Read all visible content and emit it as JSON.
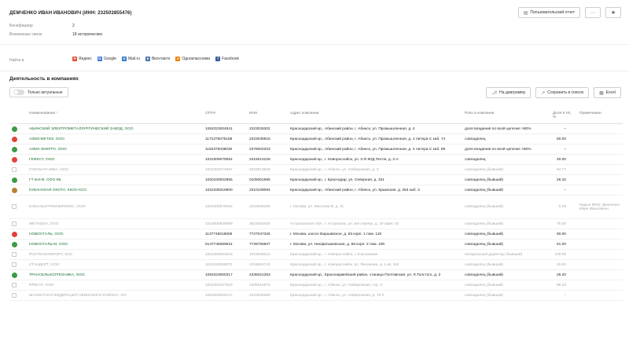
{
  "header": {
    "title": "ДЕМЧЕНКО ИВАН ИВАНОВИЧ (ИНН: 232503855476)",
    "user_report_label": "Пользовательский отчет",
    "more_label": "···",
    "star_label": "★"
  },
  "meta": [
    {
      "label": "Бенефициар",
      "value": "2"
    },
    {
      "label": "Возможные связи",
      "value": "18 исторических"
    }
  ],
  "find": {
    "label": "Найти в",
    "links": [
      {
        "label": "Яндекс",
        "icon": "yandex-icon",
        "glyph": "Я",
        "color": "#e34b32"
      },
      {
        "label": "Google",
        "icon": "google-icon",
        "glyph": "G",
        "color": "#4a7bdc"
      },
      {
        "label": "Mail.ru",
        "icon": "mailru-icon",
        "glyph": "@",
        "color": "#2a70c8"
      },
      {
        "label": "Вконтакте",
        "icon": "vk-icon",
        "glyph": "в",
        "color": "#4a76a8"
      },
      {
        "label": "Одноклассники",
        "icon": "ok-icon",
        "glyph": "о",
        "color": "#ee8208"
      },
      {
        "label": "Facebook",
        "icon": "facebook-icon",
        "glyph": "f",
        "color": "#3b5998"
      }
    ]
  },
  "section": {
    "title": "Деятельность в компаниях",
    "toggle_label": "Только актуальные",
    "diagram_label": "На диаграмму",
    "save_label": "Сохранить в список",
    "export_label": "Excel"
  },
  "table": {
    "columns": [
      "Наименование ↑",
      "ОГРН",
      "ИНН",
      "Адрес компании",
      "Роль в компании",
      "Доля в УК, %",
      "Примечание"
    ],
    "rows": [
      {
        "status": "green",
        "name": "АБИНСКИЙ ЭЛЕКТРОМЕТАЛЛУРГИЧЕСКИЙ ЗАВОД, ООО",
        "ogrn": "1062323004941",
        "inn": "2323025302",
        "address": "Краснодарский кр., Абинский район, г. Абинск, ул. Промышленная, д. 4",
        "role": "доля владения по всей цепочке >50%",
        "share": "–",
        "note": "",
        "active": true
      },
      {
        "status": "red",
        "name": "АЗМЗ-МЕТИЗ, ООО",
        "ogrn": "1172375075168",
        "inn": "2323035815",
        "address": "Краснодарский кр., Абинский район, г. Абинск, ул. Промышленная, д. 4 литера С каб. 74",
        "role": "совладелец",
        "share": "50.00",
        "note": "",
        "active": true
      },
      {
        "status": "green",
        "name": "АЗМЗ-ЭНЕРГО, ООО",
        "ogrn": "1192375038030",
        "inn": "2376002203",
        "address": "Краснодарский кр., Абинский район, г. Абинск, ул. Промышленная, д. 4 литера С каб. 69",
        "role": "доля владения по всей цепочке >50%",
        "share": "–",
        "note": "",
        "active": true
      },
      {
        "status": "red",
        "name": "ГЕФЕСТ, ООО",
        "ogrn": "1022309079054",
        "inn": "2315014226",
        "address": "Краснодарский кр., г. Новороссийск, ул. 2-Я Ж/Д Петля, д. 2-А",
        "role": "совладелец",
        "share": "20.00",
        "note": "",
        "active": true
      },
      {
        "status": "gray",
        "name": "ГОЛУБАЯ НИВА, ООО",
        "ogrn": "1022303274667",
        "inn": "2323013628",
        "address": "Краснодарский кр., г. Абинск, ул. Набережная, д. 3",
        "role": "совладелец (бывший)",
        "share": "94.77",
        "note": "",
        "active": false
      },
      {
        "status": "green",
        "name": "ГТ БАНК, ООО КБ",
        "ogrn": "1020100002955",
        "inn": "0105001895",
        "address": "Краснодарский кр., г. Краснодар, ул. Северная, д. 321",
        "role": "совладелец (бывший)",
        "share": "26.32",
        "note": "",
        "active": true
      },
      {
        "status": "brown",
        "name": "КУБАНСКАЯ ОХОТА, ККОО КСО",
        "ogrn": "1022335018900",
        "inn": "2310109094",
        "address": "Краснодарский кр., Абинский район, г. Абинск, ул. Крымская, д. 264 каб. 3",
        "role": "совладелец (бывший)",
        "share": "–",
        "note": "",
        "active": true
      },
      {
        "status": "gray",
        "name": "КУБАНЬАГРОКОМПЛЕКС, ООО",
        "ogrn": "1022300879032",
        "inn": "2323006180",
        "address": "г. Москва, ул. Маслова В, д. 11",
        "role": "совладелец (бывший)",
        "share": "0.28",
        "note": "Кадын ФИО: Демченко Иван Ивановичн",
        "active": false,
        "tall": true
      },
      {
        "status": "gray",
        "name": "МЕТИЗОН, ООО",
        "ogrn": "1023000830999",
        "inn": "3015062020",
        "address": "Астраханская обл., г. Астрахань, ул. Бестерева, д. 19 офис 40",
        "role": "совладелец (бывший)",
        "share": "75.00",
        "note": "",
        "active": false
      },
      {
        "status": "red",
        "name": "НОВОСТАЛЬ, ООО",
        "ogrn": "1137746018605",
        "inn": "7727047326",
        "address": "г. Москва, шоссе Варшавское, д. 63 корп. 1 пом. 119",
        "role": "совладелец (бывший)",
        "share": "60.00",
        "note": "",
        "active": true
      },
      {
        "status": "green",
        "name": "НОВОСТАЛЬ-М, ООО",
        "ogrn": "5147746069631",
        "inn": "7726755607",
        "address": "г. Москва, ул. Нисфильмовская, д. 68 корп. 2 пом. 190",
        "role": "совладелец (бывший)",
        "share": "51.00",
        "note": "",
        "active": true
      },
      {
        "status": "gray",
        "name": "РОСТЕХКОМПОРТ, ЗАО",
        "ogrn": "1022309053443",
        "inn": "2315035014",
        "address": "Краснодарский кр., г. Новороссийск, г. Корсаковое",
        "role": "генеральный директор (бывший)",
        "share": "100.00",
        "note": "",
        "active": false
      },
      {
        "status": "gray",
        "name": "СТАНДАРТ, ООО",
        "ogrn": "1162310055972",
        "inn": "2315991743",
        "address": "Краснодарский кр., г. Новороссийск, ул. Фисанова, д. 1 кв. 119",
        "role": "совладелец (бывший)",
        "share": "40.00",
        "note": "",
        "active": false
      },
      {
        "status": "green",
        "name": "ТРАНСЕЛЬХОЗТЕХНИКА, ООО",
        "ogrn": "1092323000317",
        "inn": "2336021353",
        "address": "Краснодарский кр., Красноармейский район, станица Полтавская, ул. Л.Толстого, д. 2",
        "role": "совладелец (бывший)",
        "share": "26.20",
        "note": "",
        "active": true
      },
      {
        "status": "gray",
        "name": "ФРЕГАТ, ООО",
        "ogrn": "1022302327520",
        "inn": "2308015973",
        "address": "Краснодарский кр., г. Абинск, ул. Набережная, стр. 3",
        "role": "совладелец (бывший)",
        "share": "85.33",
        "note": "",
        "active": false
      },
      {
        "status": "gray",
        "name": "ШАХМАТНАЯ ФЕДЕРАЦИЯ АБИНСКОГО РАЙОНА, ОО",
        "ogrn": "1082300000147",
        "inn": "2323030080",
        "address": "Краснодарский кр., г. Абинск, ул. Набережная, д. 79 б",
        "role": "совладелец (бывший)",
        "share": "–",
        "note": "",
        "active": false
      }
    ]
  }
}
